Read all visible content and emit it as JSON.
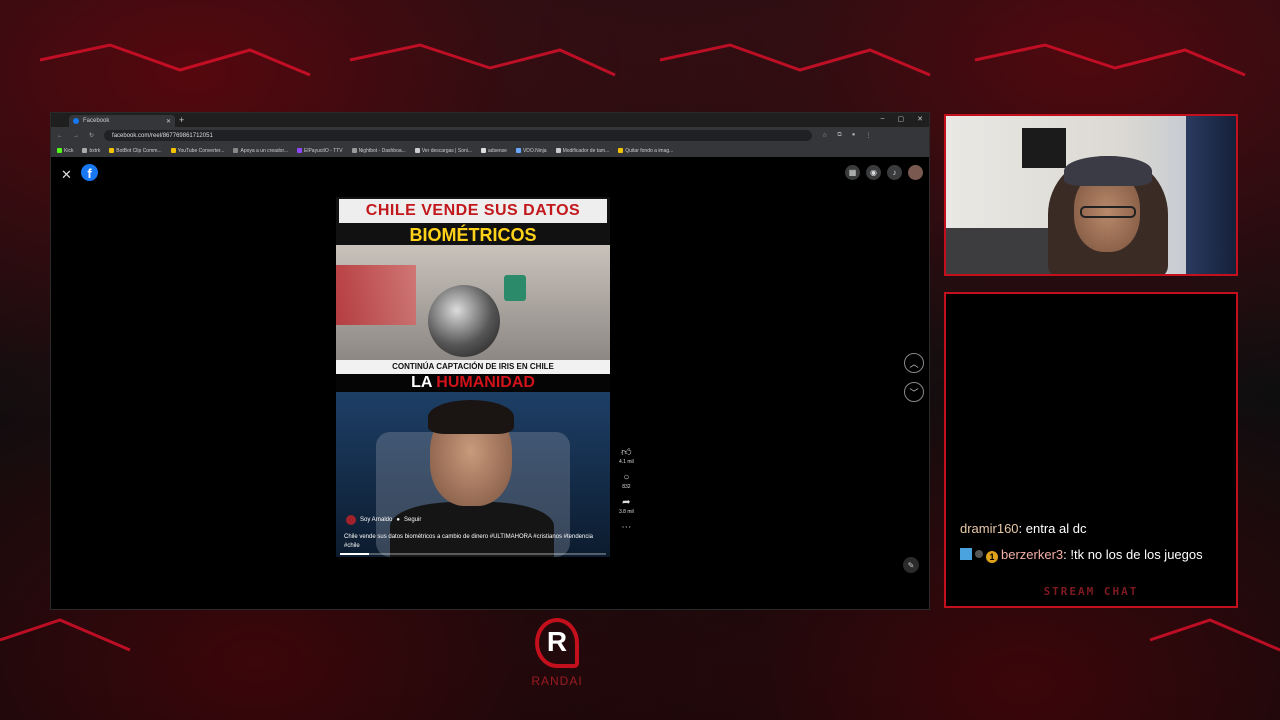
{
  "browser": {
    "tab_title": "Facebook",
    "url": "facebook.com/reel/867769861712051",
    "bookmarks": [
      "Kick",
      "bxtrk",
      "BotBot Clip Comm...",
      "YouTube Converter...",
      "Apoya a un creador...",
      "ElPayucitO - TTV",
      "Nightbot - Dashboa...",
      "Ver descargas | Soni...",
      "adsense",
      "VDO.Ninja",
      "Modificador de tam...",
      "Quitar fondo a imag..."
    ]
  },
  "reel": {
    "headline": "CHILE VENDE SUS DATOS",
    "subheadline": "BIOMÉTRICOS",
    "news_caption": "CONTINÚA CAPTACIÓN DE IRIS EN CHILE",
    "overlay_white": "LA ",
    "overlay_red": "HUMANIDAD",
    "author": "Soy Arnaldo",
    "follow": "Seguir",
    "description": "Chile vende sus datos biométricos a cambio de dinero #ULTIMAHORA #cristianos #tendencia #chile",
    "likes": "4.1 mil",
    "comments": "832",
    "shares": "3.8 mil",
    "progress": 0.11
  },
  "chat": {
    "messages": [
      {
        "user": "dramir160",
        "text": ": entra al dc"
      },
      {
        "user": "berzerker3",
        "text": ": !tk no los de los juegos"
      }
    ],
    "title": "STREAM CHAT"
  },
  "brand": {
    "name": "RANDAI",
    "mark": "R"
  },
  "colors": {
    "accent_red": "#c40f1d",
    "facebook_blue": "#1877f2",
    "headline_red": "#c2181c",
    "subheadline_yellow": "#ffd21a"
  }
}
